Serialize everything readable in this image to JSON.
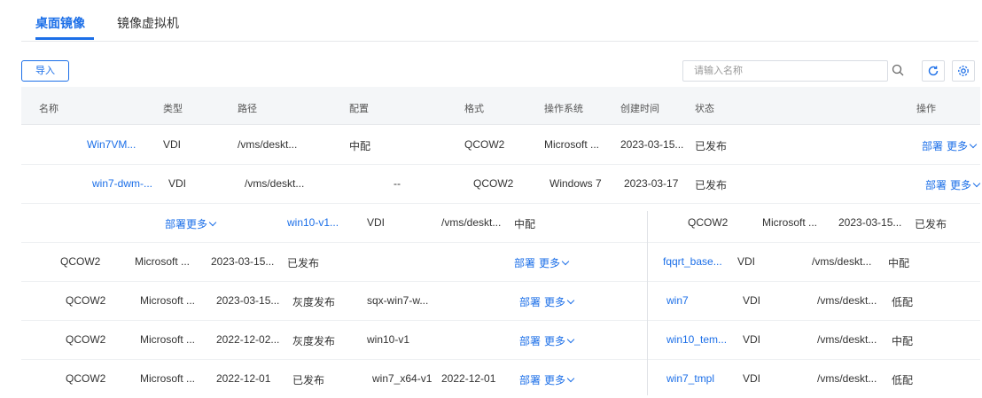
{
  "tabs": [
    {
      "label": "桌面镜像",
      "active": true
    },
    {
      "label": "镜像虚拟机",
      "active": false
    }
  ],
  "toolbar": {
    "import_label": "导入",
    "search_placeholder": "请输入名称"
  },
  "icons": {
    "search": "search-icon",
    "refresh": "refresh-icon",
    "settings": "settings-icon"
  },
  "table": {
    "headers": [
      "名称",
      "类型",
      "路径",
      "配置",
      "格式",
      "操作系统",
      "创建时间",
      "状态",
      "操作"
    ],
    "rows": [
      {
        "name": "Win7VM...",
        "type": "VDI",
        "path": "/vms/deskt...",
        "config": "中配",
        "format": "QCOW2",
        "os": "Microsoft ...",
        "time": "2023-03-15...",
        "status": "已发布",
        "deploy": "部署",
        "more": "更多"
      },
      {
        "name": "win7-dwm-...",
        "type": "VDI",
        "path": "/vms/deskt...",
        "config": "--",
        "format": "QCOW2",
        "os": "Windows 7",
        "time": "2023-03-17",
        "status": "已发布",
        "deploy": "部署",
        "more": "更多"
      },
      {
        "name": "win10-v1...",
        "type": "VDI",
        "path": "/vms/deskt...",
        "config": "中配",
        "format": "QCOW2",
        "os": "Microsoft ...",
        "time": "2023-03-15...",
        "status": "已发布",
        "deploy": "部署",
        "more": "更多"
      },
      {
        "name": "fqqrt_base...",
        "type": "VDI",
        "path": "/vms/deskt...",
        "config": "中配",
        "format": "QCOW2",
        "os": "Microsoft ...",
        "time": "2023-03-15...",
        "status": "已发布",
        "deploy": "部署",
        "more": "更多"
      },
      {
        "name": "win7",
        "type": "VDI",
        "path": "/vms/deskt...",
        "config": "低配",
        "format": "QCOW2",
        "os": "Microsoft ...",
        "time": "2023-03-15...",
        "status": "灰度发布",
        "deploy": "部署",
        "more": "更多",
        "extra": "sqx-win7-w..."
      },
      {
        "name": "win10_tem...",
        "type": "VDI",
        "path": "/vms/deskt...",
        "config": "中配",
        "format": "QCOW2",
        "os": "Microsoft ...",
        "time": "2022-12-02...",
        "status": "灰度发布",
        "deploy": "部署",
        "more": "更多",
        "extra": "win10-v1"
      },
      {
        "name": "win7_tmpl",
        "type": "VDI",
        "path": "/vms/deskt...",
        "config": "低配",
        "format": "QCOW2",
        "os": "Microsoft ...",
        "time": "2022-12-01",
        "status": "已发布",
        "deploy": "部署",
        "more": "更多",
        "extra": "win7_x64-v1",
        "extra_time": "2022-12-01"
      }
    ]
  },
  "colors": {
    "accent": "#1c6fe8",
    "header_bg": "#f4f6f8",
    "border": "#e6e8eb"
  }
}
